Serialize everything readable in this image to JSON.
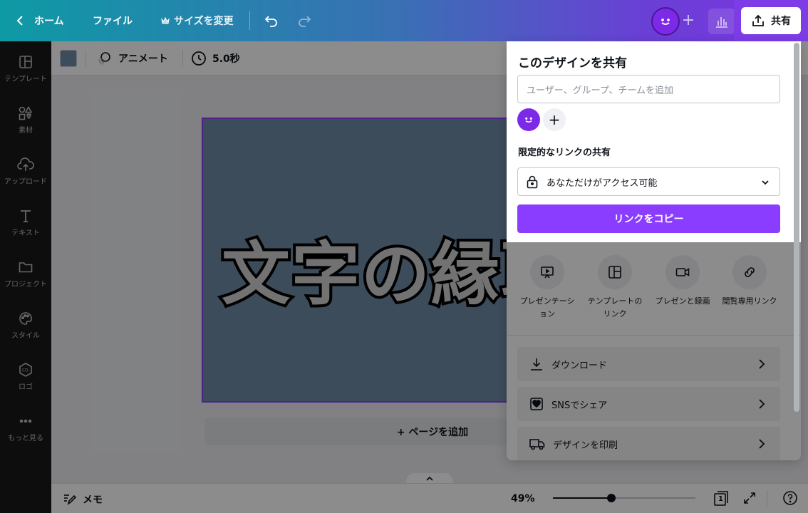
{
  "topbar": {
    "home_label": "ホーム",
    "file_label": "ファイル",
    "resize_label": "サイズを変更",
    "share_label": "共有"
  },
  "sidebar": {
    "items": [
      {
        "label": "テンプレート",
        "icon": "template-icon"
      },
      {
        "label": "素材",
        "icon": "elements-icon"
      },
      {
        "label": "アップロード",
        "icon": "upload-icon"
      },
      {
        "label": "テキスト",
        "icon": "text-icon"
      },
      {
        "label": "プロジェクト",
        "icon": "folder-icon"
      },
      {
        "label": "スタイル",
        "icon": "palette-icon"
      },
      {
        "label": "ロゴ",
        "icon": "logo-icon"
      },
      {
        "label": "もっと見る",
        "icon": "more-icon"
      }
    ]
  },
  "toolbar": {
    "animate_label": "アニメート",
    "duration_label": "5.0秒"
  },
  "canvas": {
    "design_text": "文字の縁取",
    "add_page_label": "+ ページを追加"
  },
  "bottombar": {
    "notes_label": "メモ",
    "zoom_label": "49%",
    "zoom_fraction": 0.41,
    "page_number": "1"
  },
  "share_panel": {
    "title": "このデザインを共有",
    "input_placeholder": "ユーザー、グループ、チームを追加",
    "link_section_title": "限定的なリンクの共有",
    "access_option": "あなただけがアクセス可能",
    "copy_link_label": "リンクをコピー",
    "options": [
      {
        "label_line1": "プレゼンテーシ",
        "label_line2": "ョン",
        "icon": "presentation-icon"
      },
      {
        "label_line1": "テンプレートの",
        "label_line2": "リンク",
        "icon": "template-link-icon"
      },
      {
        "label_line1": "プレゼンと録画",
        "label_line2": "",
        "icon": "video-icon"
      },
      {
        "label_line1": "閲覧専用リンク",
        "label_line2": "",
        "icon": "link-icon"
      }
    ],
    "rows": [
      {
        "label": "ダウンロード",
        "icon": "download-icon"
      },
      {
        "label": "SNSでシェア",
        "icon": "heart-icon"
      },
      {
        "label": "デザインを印刷",
        "icon": "truck-icon"
      }
    ]
  },
  "colors": {
    "accent": "#8b3dff",
    "avatar": "#7d2ae8",
    "sidebar_bg": "#18191b",
    "design_bg": "#6d8aa6"
  }
}
